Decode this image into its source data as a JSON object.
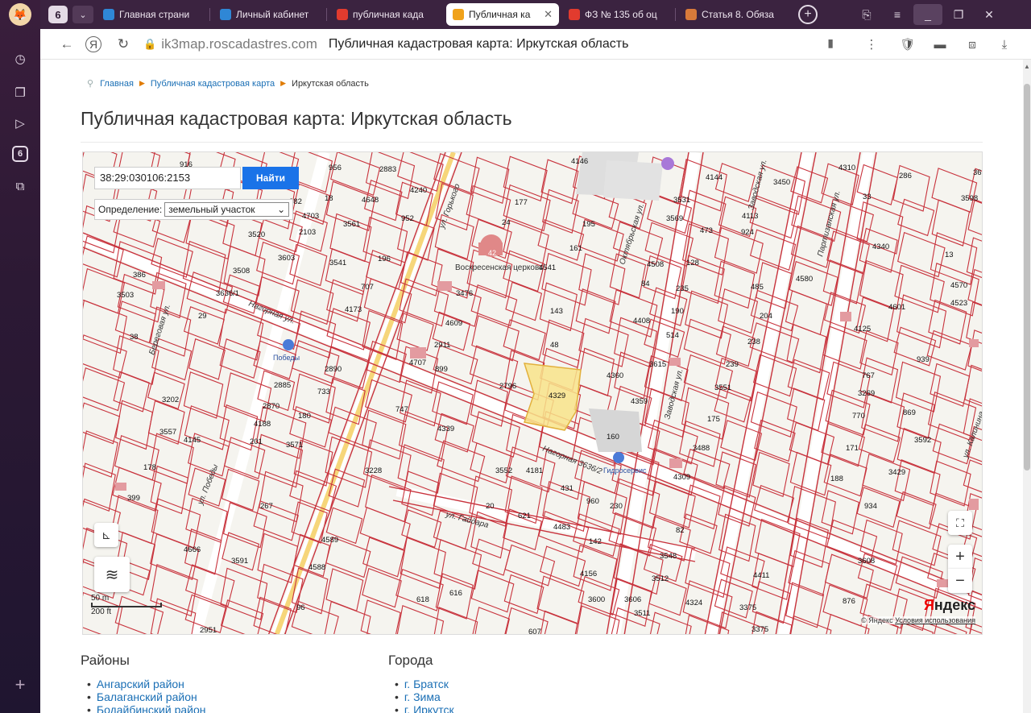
{
  "browser": {
    "tab_count": "6",
    "tabs": [
      {
        "label": "Главная страни",
        "color": "#2f87d6"
      },
      {
        "label": "Личный кабинет",
        "color": "#2f87d6"
      },
      {
        "label": "публичная када",
        "color": "#e23b2e"
      },
      {
        "label": "Публичная ка",
        "color": "#f0a21a",
        "active": true
      },
      {
        "label": "ФЗ № 135 об оц",
        "color": "#e23b2e"
      },
      {
        "label": "Статья 8. Обяза",
        "color": "#d87a3a"
      }
    ],
    "domain": "ik3map.roscadastres.com",
    "page_title": "Публичная кадастровая карта: Иркутская область"
  },
  "breadcrumb": {
    "home": "Главная",
    "map": "Публичная кадастровая карта",
    "current": "Иркутская область"
  },
  "heading": "Публичная кадастровая карта: Иркутская область",
  "map": {
    "search_value": "38:29:030106:2153",
    "search_button": "Найти",
    "definition_label": "Определение:",
    "definition_value": "земельный участок",
    "scale_m": "50 m",
    "scale_ft": "200 ft",
    "logo_y": "Я",
    "logo_rest": "ндекс",
    "copyright": "© Яндекс",
    "terms": "Условия использования",
    "zoom_in": "+",
    "zoom_out": "−",
    "streets": {
      "gorkogo": "ул. Горького",
      "nagornaya_left": "Нагорная ул.",
      "nagornaya_right": "Нагорная 3636/2",
      "gaidara": "ул. Гайдара",
      "oktyabrskaya": "Октябрьская ул.",
      "zavodskaya": "Заводская ул.",
      "partizanskaya": "Партизанская ул.",
      "beregovaya": "Береговая ул.",
      "pobedy": "ул. Победы",
      "kalinina": "ул. Калинина",
      "church": "Воскресенская церковь",
      "church_num": "42",
      "bus_left": "Победы",
      "bus_right": "Гидросервис"
    },
    "labels": [
      [
        "916",
        120,
        8
      ],
      [
        "956",
        305,
        12
      ],
      [
        "2883",
        368,
        14
      ],
      [
        "4240",
        406,
        40
      ],
      [
        "4146",
        606,
        4
      ],
      [
        "4144",
        773,
        24
      ],
      [
        "3450",
        857,
        30
      ],
      [
        "4310",
        938,
        12
      ],
      [
        "286",
        1013,
        22
      ],
      [
        "3598",
        1090,
        50
      ],
      [
        "36",
        1105,
        18
      ],
      [
        "18",
        300,
        50
      ],
      [
        "4648",
        346,
        52
      ],
      [
        "952",
        395,
        75
      ],
      [
        "177",
        536,
        55
      ],
      [
        "195",
        620,
        82
      ],
      [
        "3531",
        733,
        52
      ],
      [
        "3569",
        724,
        75
      ],
      [
        "473",
        766,
        90
      ],
      [
        "4113",
        818,
        72
      ],
      [
        "924",
        817,
        92
      ],
      [
        "33",
        968,
        48
      ],
      [
        "3520",
        205,
        95
      ],
      [
        "382",
        256,
        54
      ],
      [
        "4703",
        272,
        72
      ],
      [
        "2103",
        268,
        92
      ],
      [
        "3561",
        323,
        82
      ],
      [
        "24",
        520,
        80
      ],
      [
        "161",
        604,
        112
      ],
      [
        "4340",
        980,
        110
      ],
      [
        "13",
        1070,
        120
      ],
      [
        "386",
        62,
        145
      ],
      [
        "3508",
        186,
        140
      ],
      [
        "3603",
        242,
        124
      ],
      [
        "3541",
        306,
        130
      ],
      [
        "196",
        366,
        125
      ],
      [
        "4541",
        566,
        136
      ],
      [
        "128",
        749,
        130
      ],
      [
        "4508",
        700,
        132
      ],
      [
        "4570",
        1077,
        158
      ],
      [
        "3503",
        42,
        170
      ],
      [
        "3636/1",
        165,
        168
      ],
      [
        "707",
        345,
        160
      ],
      [
        "3476",
        463,
        168
      ],
      [
        "84",
        693,
        156
      ],
      [
        "235",
        736,
        162
      ],
      [
        "485",
        829,
        160
      ],
      [
        "4580",
        885,
        150
      ],
      [
        "4601",
        1000,
        185
      ],
      [
        "4523",
        1077,
        180
      ],
      [
        "4173",
        325,
        188
      ],
      [
        "143",
        580,
        190
      ],
      [
        "190",
        730,
        190
      ],
      [
        "204",
        840,
        196
      ],
      [
        "4125",
        957,
        212
      ],
      [
        "29",
        143,
        196
      ],
      [
        "4609",
        450,
        205
      ],
      [
        "4408",
        683,
        202
      ],
      [
        "514",
        724,
        220
      ],
      [
        "238",
        825,
        228
      ],
      [
        "38",
        58,
        222
      ],
      [
        "2911",
        436,
        232
      ],
      [
        "48",
        580,
        232
      ],
      [
        "939",
        1035,
        250
      ],
      [
        "3615",
        703,
        256
      ],
      [
        "239",
        798,
        256
      ],
      [
        "4360",
        650,
        270
      ],
      [
        "4707",
        405,
        254
      ],
      [
        "899",
        437,
        262
      ],
      [
        "2890",
        300,
        262
      ],
      [
        "767",
        967,
        270
      ],
      [
        "2885",
        237,
        282
      ],
      [
        "733",
        291,
        290
      ],
      [
        "3551",
        784,
        285
      ],
      [
        "2796",
        517,
        283
      ],
      [
        "4329",
        578,
        295
      ],
      [
        "3269",
        962,
        292
      ],
      [
        "3202",
        98,
        300
      ],
      [
        "4359",
        680,
        302
      ],
      [
        "869",
        1018,
        316
      ],
      [
        "2870",
        223,
        308
      ],
      [
        "180",
        267,
        320
      ],
      [
        "747",
        388,
        312
      ],
      [
        "175",
        775,
        324
      ],
      [
        "770",
        955,
        320
      ],
      [
        "4188",
        212,
        330
      ],
      [
        "4339",
        440,
        336
      ],
      [
        "160",
        650,
        346
      ],
      [
        "3592",
        1032,
        350
      ],
      [
        "3557",
        95,
        340
      ],
      [
        "4145",
        125,
        350
      ],
      [
        "201",
        207,
        352
      ],
      [
        "3571",
        252,
        356
      ],
      [
        "171",
        947,
        360
      ],
      [
        "3488",
        757,
        360
      ],
      [
        "178",
        75,
        384
      ],
      [
        "3228",
        350,
        388
      ],
      [
        "4181",
        550,
        388
      ],
      [
        "3552",
        512,
        388
      ],
      [
        "3429",
        1000,
        390
      ],
      [
        "188",
        928,
        398
      ],
      [
        "4309",
        733,
        396
      ],
      [
        "431",
        593,
        410
      ],
      [
        "399",
        55,
        422
      ],
      [
        "267",
        220,
        432
      ],
      [
        "621",
        540,
        444
      ],
      [
        "934",
        970,
        432
      ],
      [
        "20",
        500,
        432
      ],
      [
        "960",
        625,
        426
      ],
      [
        "230",
        654,
        432
      ],
      [
        "4483",
        584,
        458
      ],
      [
        "142",
        628,
        476
      ],
      [
        "82",
        736,
        462
      ],
      [
        "4589",
        296,
        474
      ],
      [
        "4666",
        125,
        486
      ],
      [
        "3591",
        184,
        500
      ],
      [
        "4588",
        280,
        508
      ],
      [
        "3548",
        716,
        494
      ],
      [
        "3512",
        706,
        522
      ],
      [
        "4411",
        832,
        518
      ],
      [
        "876",
        943,
        550
      ],
      [
        "4156",
        617,
        516
      ],
      [
        "618",
        414,
        548
      ],
      [
        "616",
        455,
        540
      ],
      [
        "3606",
        672,
        548
      ],
      [
        "3375",
        815,
        558
      ],
      [
        "3375",
        830,
        585
      ],
      [
        "96",
        265,
        558
      ],
      [
        "2951",
        145,
        586
      ],
      [
        "607",
        553,
        588
      ],
      [
        "3600",
        627,
        548
      ],
      [
        "3511",
        684,
        565
      ],
      [
        "4324",
        748,
        552
      ],
      [
        "3608",
        962,
        500
      ]
    ]
  },
  "regions": {
    "title": "Районы",
    "items": [
      "Ангарский район",
      "Балаганский район",
      "Бодайбинский район"
    ]
  },
  "cities": {
    "title": "Города",
    "items": [
      "г. Братск",
      "г. Зима",
      "г. Иркутск"
    ]
  },
  "colors": {
    "parcel_line": "#c8323c",
    "highlight": "#f8e38a",
    "road": "#f6d67a"
  }
}
